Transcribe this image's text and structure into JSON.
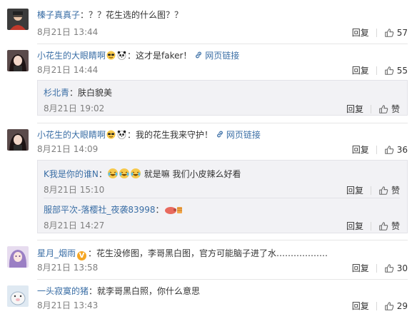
{
  "comments": [
    {
      "user": "榛子真真子",
      "text": "：？？花生选的什么图？？",
      "time": "8月21日 13:44",
      "reply": "回复",
      "likes": "57"
    },
    {
      "user": "小花生的大眼睛啊",
      "text": "：这才是faker！",
      "link": "网页链接",
      "time": "8月21日 14:44",
      "reply": "回复",
      "likes": "55",
      "replies": [
        {
          "user": "杉北青",
          "text": "：肤白貌美",
          "time": "8月21日 19:02",
          "reply": "回复",
          "likes": "赞"
        }
      ]
    },
    {
      "user": "小花生的大眼睛啊",
      "text": "：我的花生我来守护！",
      "link": "网页链接",
      "time": "8月21日 14:09",
      "reply": "回复",
      "likes": "36",
      "replies": [
        {
          "user": "K我是你的谁N",
          "text": "：",
          "text2": "就是嘛 我们小皮辣么好看",
          "time": "8月21日 15:10",
          "reply": "回复",
          "likes": "赞"
        },
        {
          "user": "服部平次-落樱社_夜袭83998",
          "text": "：",
          "time": "8月21日 14:27",
          "reply": "回复",
          "likes": "赞"
        }
      ]
    },
    {
      "user": "星月_烟雨",
      "text": "：花生没修图，李哥黑白图，官方可能脑子进了水………………",
      "time": "8月21日 13:58",
      "reply": "回复",
      "likes": "30"
    },
    {
      "user": "一头寂寞的猪",
      "text": "：就李哥黑白照，你什么意思",
      "time": "8月21日 13:43",
      "reply": "回复",
      "likes": "29"
    }
  ],
  "colors": {
    "username": "#3a6ea5",
    "timestamp": "#808080",
    "reply_bg": "#f2f2f5"
  }
}
